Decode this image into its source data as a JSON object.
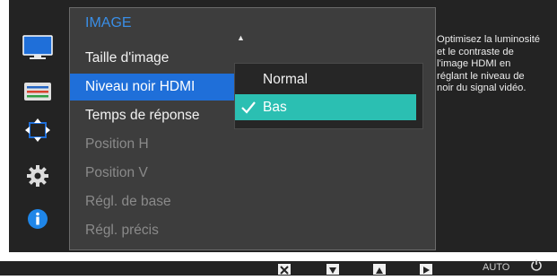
{
  "menu": {
    "title": "IMAGE",
    "scroll_up_icon": "triangle-up-icon",
    "items": [
      {
        "label": "Taille d'image",
        "state": "enabled"
      },
      {
        "label": "Niveau noir HDMI",
        "state": "selected"
      },
      {
        "label": "Temps de réponse",
        "state": "enabled"
      },
      {
        "label": "Position H",
        "state": "disabled"
      },
      {
        "label": "Position V",
        "state": "disabled"
      },
      {
        "label": "Régl. de base",
        "state": "disabled"
      },
      {
        "label": "Régl. précis",
        "state": "disabled"
      }
    ]
  },
  "submenu": {
    "options": [
      {
        "label": "Normal",
        "selected": false
      },
      {
        "label": "Bas",
        "selected": true
      }
    ],
    "check_icon": "checkmark-icon"
  },
  "help_text": "Optimisez la luminosité\net le contraste de\nl'image HDMI en\nréglant le niveau de\nnoir du signal vidéo.",
  "side_icons": [
    "monitor-icon",
    "menu-list-icon",
    "resize-arrows-icon",
    "gear-icon",
    "info-icon"
  ],
  "bottom_buttons": [
    "close-icon",
    "down-arrow-icon",
    "up-arrow-icon",
    "right-arrow-icon"
  ],
  "bottom_auto": "AUTO",
  "colors": {
    "accent_blue": "#1f6fd9",
    "title_blue": "#3a8ee6",
    "selected_teal": "#2bbfb2",
    "panel": "#3d3d3d",
    "background": "#232323"
  }
}
